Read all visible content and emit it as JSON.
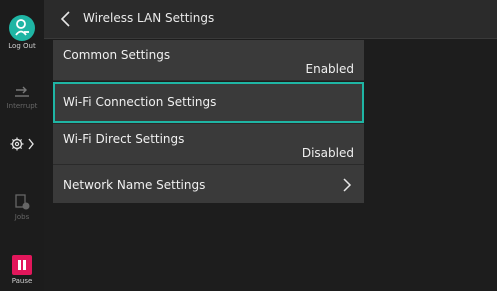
{
  "rail": {
    "logout_label": "Log Out",
    "interrupt_label": "Interrupt",
    "jobs_label": "Jobs",
    "pause_label": "Pause"
  },
  "header": {
    "title": "Wireless LAN Settings"
  },
  "settings": [
    {
      "label": "Common Settings",
      "value": "Enabled"
    },
    {
      "label": "Wi-Fi Connection Settings",
      "value": ""
    },
    {
      "label": "Wi-Fi Direct Settings",
      "value": "Disabled"
    },
    {
      "label": "Network Name Settings",
      "value": ""
    }
  ],
  "colors": {
    "accent": "#1fb5a4",
    "pause": "#e2175b",
    "row_bg": "#3a3a3a",
    "page_bg": "#1d1d1d"
  },
  "icons": {
    "logout": "logout-person-icon",
    "interrupt": "interrupt-icon",
    "settings": "gear-icon",
    "jobs": "jobs-icon",
    "pause": "pause-icon",
    "back": "chevron-left-icon",
    "network_name_arrow": "chevron-right-icon"
  }
}
